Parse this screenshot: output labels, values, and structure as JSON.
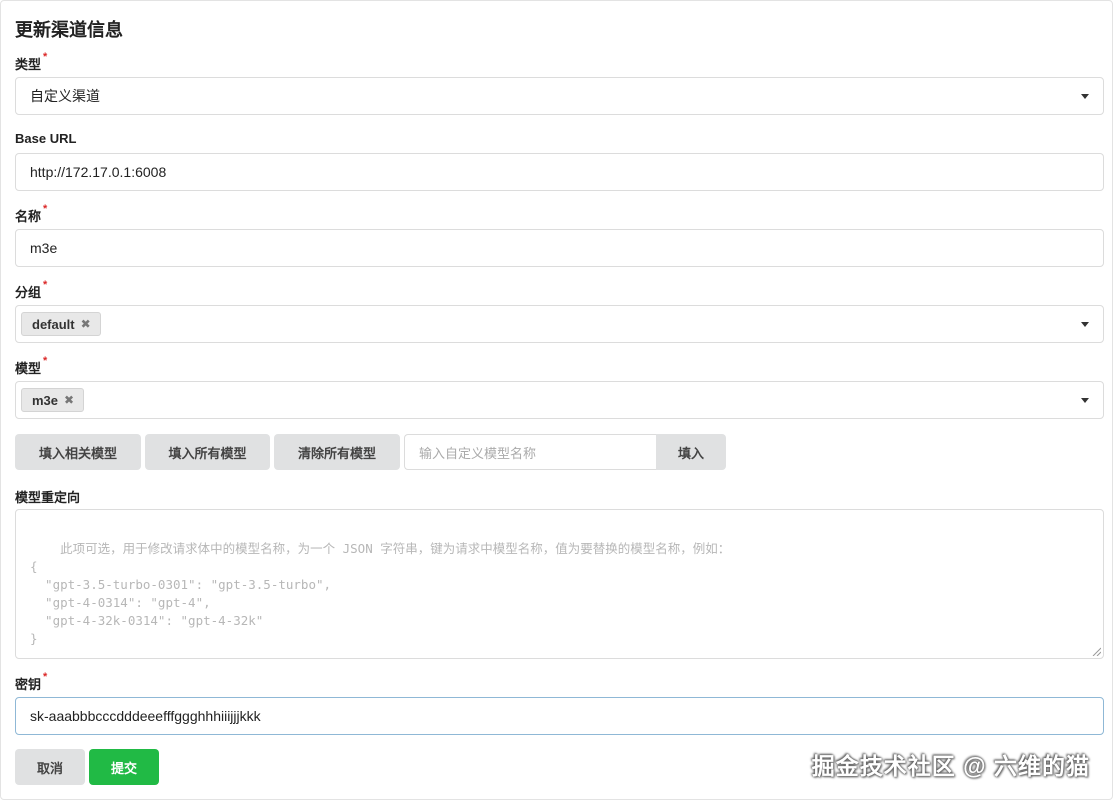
{
  "form": {
    "title": "更新渠道信息",
    "required_mark": "*",
    "type": {
      "label": "类型",
      "value": "自定义渠道"
    },
    "base_url": {
      "label": "Base URL",
      "value": "http://172.17.0.1:6008"
    },
    "name": {
      "label": "名称",
      "value": "m3e"
    },
    "group": {
      "label": "分组",
      "chips": [
        "default"
      ]
    },
    "models": {
      "label": "模型",
      "chips": [
        "m3e"
      ]
    },
    "model_buttons": {
      "fill_related": "填入相关模型",
      "fill_all": "填入所有模型",
      "clear_all": "清除所有模型",
      "custom_placeholder": "输入自定义模型名称",
      "fill": "填入"
    },
    "model_mapping": {
      "label": "模型重定向",
      "placeholder": "此项可选，用于修改请求体中的模型名称，为一个 JSON 字符串，键为请求中模型名称，值为要替换的模型名称，例如：\n{\n  \"gpt-3.5-turbo-0301\": \"gpt-3.5-turbo\",\n  \"gpt-4-0314\": \"gpt-4\",\n  \"gpt-4-32k-0314\": \"gpt-4-32k\"\n}"
    },
    "key": {
      "label": "密钥",
      "value": "sk-aaabbbcccdddeeefffggghhhiiijjjkkk"
    },
    "actions": {
      "cancel": "取消",
      "submit": "提交"
    }
  },
  "watermark": "掘金技术社区 @ 六维的猫",
  "colors": {
    "accent": "#21ba45",
    "required": "#db2828",
    "button_bg": "#e0e1e2"
  },
  "icons": {
    "dropdown": "caret-down-icon",
    "chip_remove": "close-icon"
  }
}
